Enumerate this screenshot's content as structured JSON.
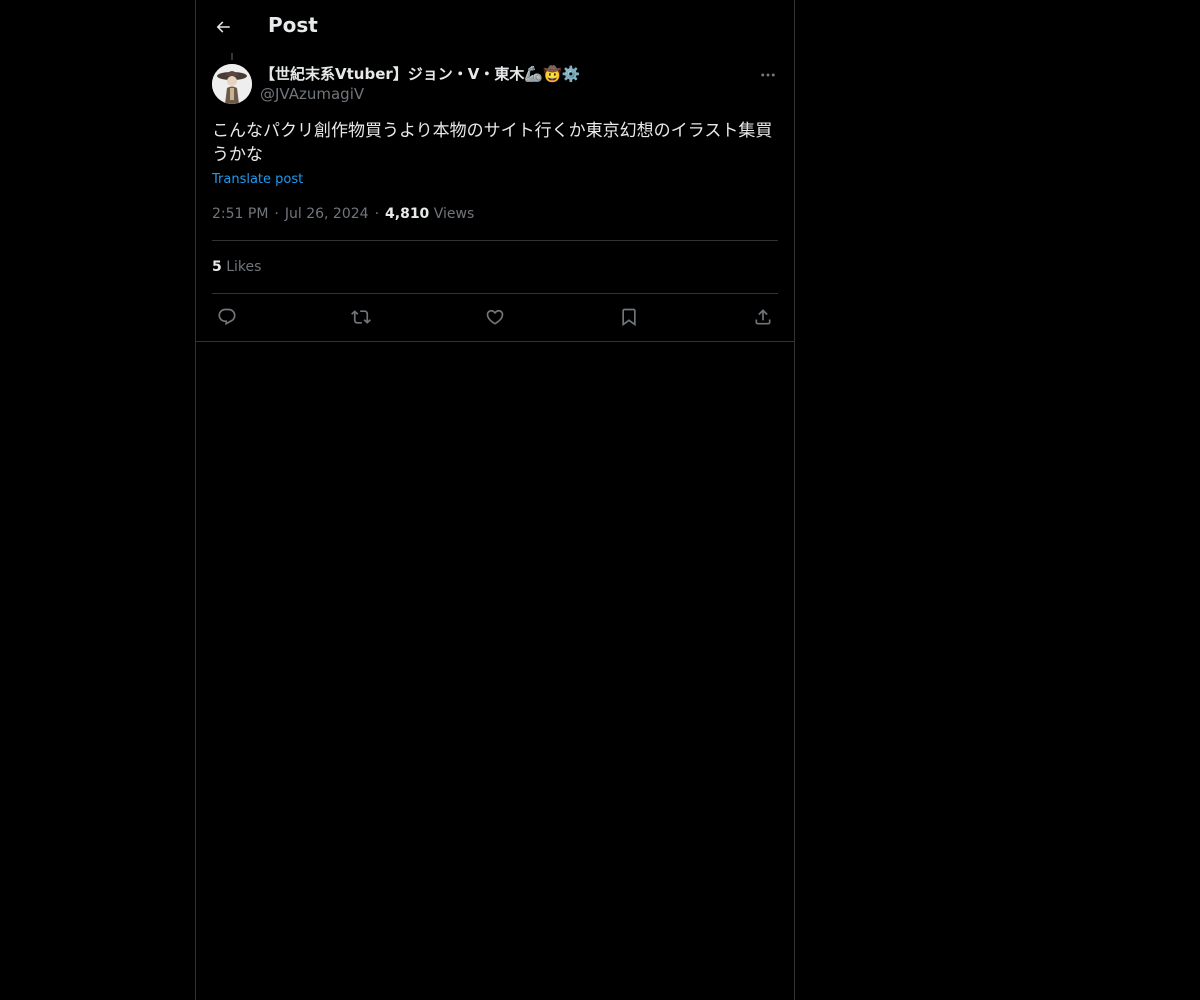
{
  "header": {
    "title": "Post",
    "back_icon": "arrow-left-icon"
  },
  "post": {
    "author": {
      "display_name": "【世紀末系Vtuber】ジョン・V・東木🦾🤠⚙️",
      "handle": "@JVAzumagiV"
    },
    "text": "こんなパクリ創作物買うより本物のサイト行くか東京幻想のイラスト集買うかな",
    "translate_label": "Translate post",
    "time": "2:51 PM",
    "date": "Jul 26, 2024",
    "separator": "·",
    "views_count": "4,810",
    "views_label": "Views",
    "likes_count": "5",
    "likes_label": "Likes"
  },
  "actions": [
    {
      "name": "reply",
      "icon": "reply-icon"
    },
    {
      "name": "repost",
      "icon": "repost-icon"
    },
    {
      "name": "like",
      "icon": "heart-icon"
    },
    {
      "name": "bookmark",
      "icon": "bookmark-icon"
    },
    {
      "name": "share",
      "icon": "share-icon"
    }
  ],
  "colors": {
    "background": "#000000",
    "text_primary": "#e7e9ea",
    "text_secondary": "#71767b",
    "link": "#1d9bf0",
    "border": "#2f3336"
  }
}
